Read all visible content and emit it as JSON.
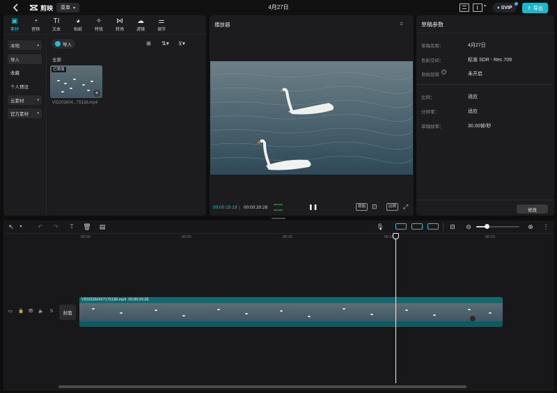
{
  "topbar": {
    "app_name": "剪映",
    "menu_label": "菜单",
    "project_title": "4月27日",
    "svip_label": "SVIP",
    "export_label": "导出"
  },
  "media_tabs": [
    {
      "label": "素材",
      "icon": "media-icon"
    },
    {
      "label": "音频",
      "icon": "audio-icon"
    },
    {
      "label": "文本",
      "icon": "text-icon"
    },
    {
      "label": "贴纸",
      "icon": "sticker-icon"
    },
    {
      "label": "特效",
      "icon": "effects-icon"
    },
    {
      "label": "转场",
      "icon": "transition-icon"
    },
    {
      "label": "滤镜",
      "icon": "filter-icon"
    },
    {
      "label": "调节",
      "icon": "adjust-icon"
    }
  ],
  "sidebar": {
    "local_label": "本地",
    "import_label": "导入",
    "favorites_label": "收藏",
    "presets_label": "个人预设",
    "cloud_label": "云素材",
    "official_label": "官方素材"
  },
  "media": {
    "import_button": "导入",
    "filter_all": "全部",
    "added_badge": "已添加",
    "file_name": "VID202604...75138.mp4"
  },
  "player": {
    "title": "播放器",
    "current_time": "00:00:15:19",
    "total_time": "00:00:20:28",
    "fit_label": "原始",
    "ratio_label": "比例"
  },
  "props": {
    "title": "草稿参数",
    "rows": [
      {
        "label": "草稿名称：",
        "value": "4月27日"
      },
      {
        "label": "色彩空间：",
        "value": "标准 SDR - Rec.709"
      },
      {
        "label": "自由层级",
        "value": "未开启"
      },
      {
        "label": "比例：",
        "value": "适应"
      },
      {
        "label": "分辨率：",
        "value": "适应"
      },
      {
        "label": "草稿帧率：",
        "value": "30.00帧/秒"
      }
    ],
    "modify_button": "修改"
  },
  "timeline": {
    "ruler": [
      "00:00",
      "00:05",
      "00:10",
      "00:15",
      "00:20"
    ],
    "cover_label": "封面",
    "clip_name": "VID20260427175138.mp4",
    "clip_duration": "00:00:20:28"
  },
  "colors": {
    "accent": "#21c3d3",
    "export": "#1fb7c8",
    "clip": "#12626a",
    "panel": "#1c1c1e"
  }
}
